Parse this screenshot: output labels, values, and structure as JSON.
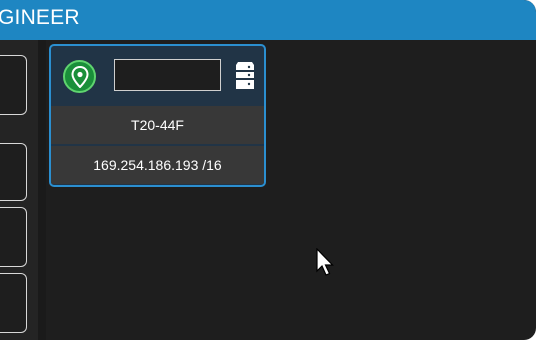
{
  "window": {
    "title": "GINEER"
  },
  "device_card": {
    "location_icon": "location-pin-icon",
    "name_field_value": "",
    "device_icon": "server-icon",
    "model": "T20-44F",
    "ip_address": "169.254.186.193 /16"
  },
  "colors": {
    "titlebar": "#1e86c2",
    "card_border": "#2b8fd0",
    "pin_green": "#1a8f3a"
  }
}
